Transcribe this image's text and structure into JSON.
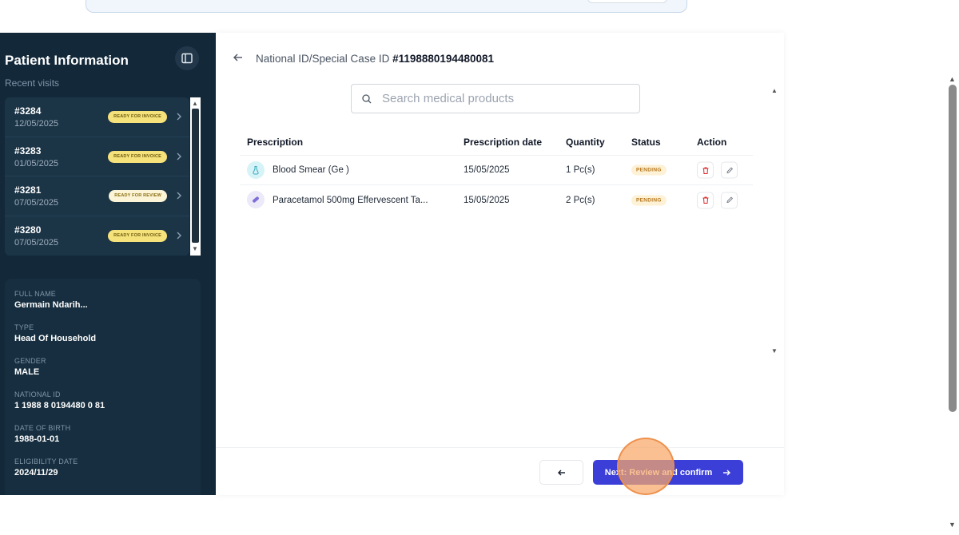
{
  "sidebar": {
    "title": "Patient Information",
    "subtitle": "Recent visits",
    "toggle_icon": "sidebar-panel-icon",
    "visits": [
      {
        "id": "#3284",
        "date": "12/05/2025",
        "status": "READY FOR INVOICE"
      },
      {
        "id": "#3283",
        "date": "01/05/2025",
        "status": "READY FOR INVOICE"
      },
      {
        "id": "#3281",
        "date": "07/05/2025",
        "status": "READY FOR REVIEW"
      },
      {
        "id": "#3280",
        "date": "07/05/2025",
        "status": "READY FOR INVOICE"
      }
    ],
    "fields": [
      {
        "label": "FULL NAME",
        "value": "Germain Ndarih..."
      },
      {
        "label": "TYPE",
        "value": "Head Of Household"
      },
      {
        "label": "GENDER",
        "value": "MALE"
      },
      {
        "label": "NATIONAL ID",
        "value": "1 1988 8 0194480 0 81"
      },
      {
        "label": "DATE OF BIRTH",
        "value": "1988-01-01"
      },
      {
        "label": "ELIGIBILITY DATE",
        "value": "2024/11/29"
      }
    ]
  },
  "main": {
    "case_label": "National ID/Special Case ID",
    "case_id": "#1198880194480081",
    "search_placeholder": "Search medical products",
    "columns": [
      "Prescription",
      "Prescription date",
      "Quantity",
      "Status",
      "Action"
    ],
    "rows": [
      {
        "icon": "flask-icon",
        "name": "Blood Smear (Ge )",
        "date": "15/05/2025",
        "quantity": "1 Pc(s)",
        "status": "PENDING"
      },
      {
        "icon": "pill-icon",
        "name": "Paracetamol 500mg Effervescent Ta...",
        "date": "15/05/2025",
        "quantity": "2 Pc(s)",
        "status": "PENDING"
      }
    ],
    "next_button": "Next: Review and confirm"
  },
  "colors": {
    "sidebar_bg": "#13293a",
    "primary_button": "#3b3fd8",
    "badge_invoice": "#f6e27a",
    "status_pending": "#fdf1d6"
  }
}
